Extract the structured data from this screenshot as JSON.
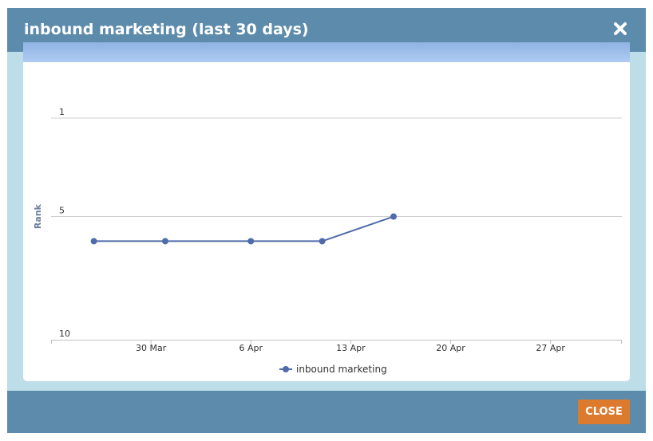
{
  "dialog": {
    "title": "inbound marketing (last 30 days)",
    "close_icon": "close-icon",
    "close_button_label": "CLOSE"
  },
  "colors": {
    "header": "#5c8bac",
    "frame": "#bddde9",
    "series": "#4f6ba9",
    "close_button": "#dc7a2e"
  },
  "chart_data": {
    "type": "line",
    "ylabel": "Rank",
    "y_reversed": true,
    "ylim": [
      1,
      10
    ],
    "y_ticks": [
      1,
      5,
      10
    ],
    "x_ticks": [
      "30 Mar",
      "6 Apr",
      "13 Apr",
      "20 Apr",
      "27 Apr"
    ],
    "x_tick_dates": [
      "2014-03-30",
      "2014-04-06",
      "2014-04-13",
      "2014-04-20",
      "2014-04-27"
    ],
    "xlim": [
      "2014-03-23",
      "2014-05-02"
    ],
    "grid": true,
    "legend_position": "bottom-center",
    "series": [
      {
        "name": "inbound marketing",
        "x": [
          "2014-03-26",
          "2014-03-31",
          "2014-04-06",
          "2014-04-11",
          "2014-04-16"
        ],
        "y": [
          6,
          6,
          6,
          6,
          5
        ]
      }
    ]
  }
}
